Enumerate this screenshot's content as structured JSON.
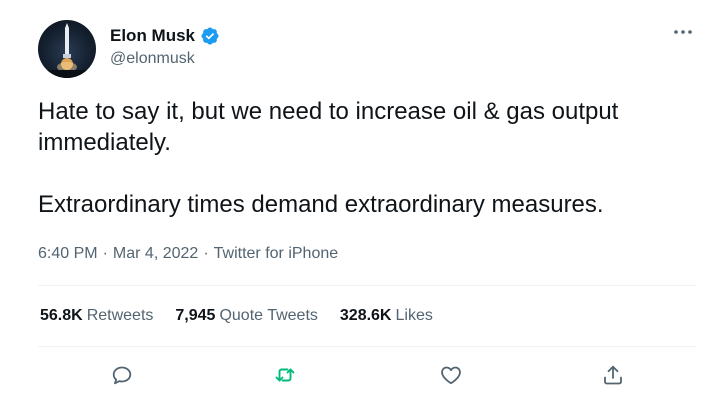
{
  "author": {
    "name": "Elon Musk",
    "handle": "@elonmusk",
    "verified_icon": "verified-badge-icon",
    "avatar_icon": "rocket-avatar"
  },
  "tweet": {
    "line1": "Hate to say it, but we need to increase oil & gas output immediately.",
    "line2": "Extraordinary times demand extraordinary measures."
  },
  "meta": {
    "time": "6:40 PM",
    "separator": "·",
    "date": "Mar 4, 2022",
    "source": "Twitter for iPhone"
  },
  "stats": {
    "retweets_count": "56.8K",
    "retweets_label": "Retweets",
    "quotes_count": "7,945",
    "quotes_label": "Quote Tweets",
    "likes_count": "328.6K",
    "likes_label": "Likes"
  },
  "actions": {
    "icons": [
      "reply-icon",
      "retweet-icon",
      "like-icon",
      "share-icon"
    ],
    "retweet_color": "#00ba7c",
    "icon_color": "#536471"
  },
  "colors": {
    "text": "#0f1419",
    "secondary": "#536471",
    "verified": "#1d9bf0",
    "divider": "#eff3f4"
  }
}
